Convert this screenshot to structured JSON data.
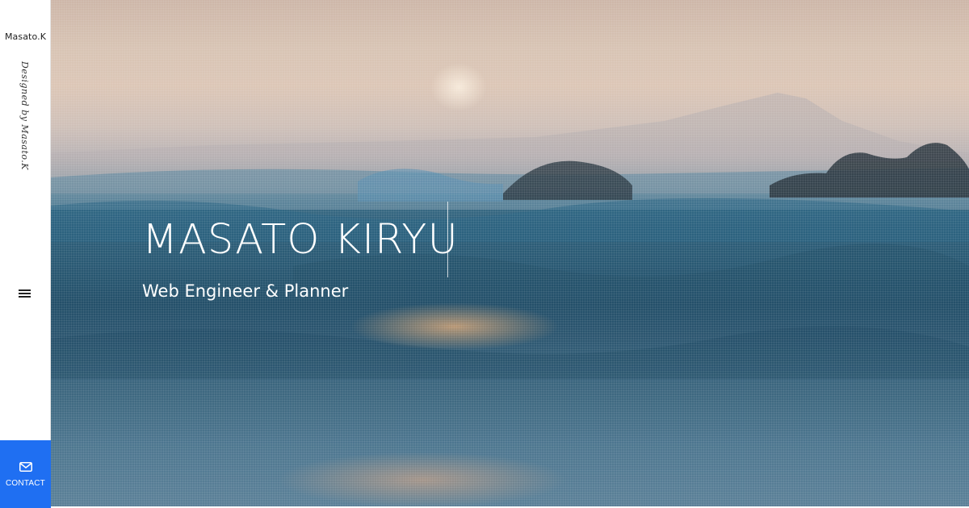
{
  "sidebar": {
    "brand": "Masato.K",
    "designed_by": "Designed by Masato.K",
    "menu_icon": "hamburger-menu-icon",
    "contact": {
      "label": "CONTACT",
      "icon": "mail-icon",
      "color": "#1f6ff2"
    }
  },
  "hero": {
    "title": "MASATO KIRYU",
    "subtitle": "Web Engineer & Planner"
  }
}
